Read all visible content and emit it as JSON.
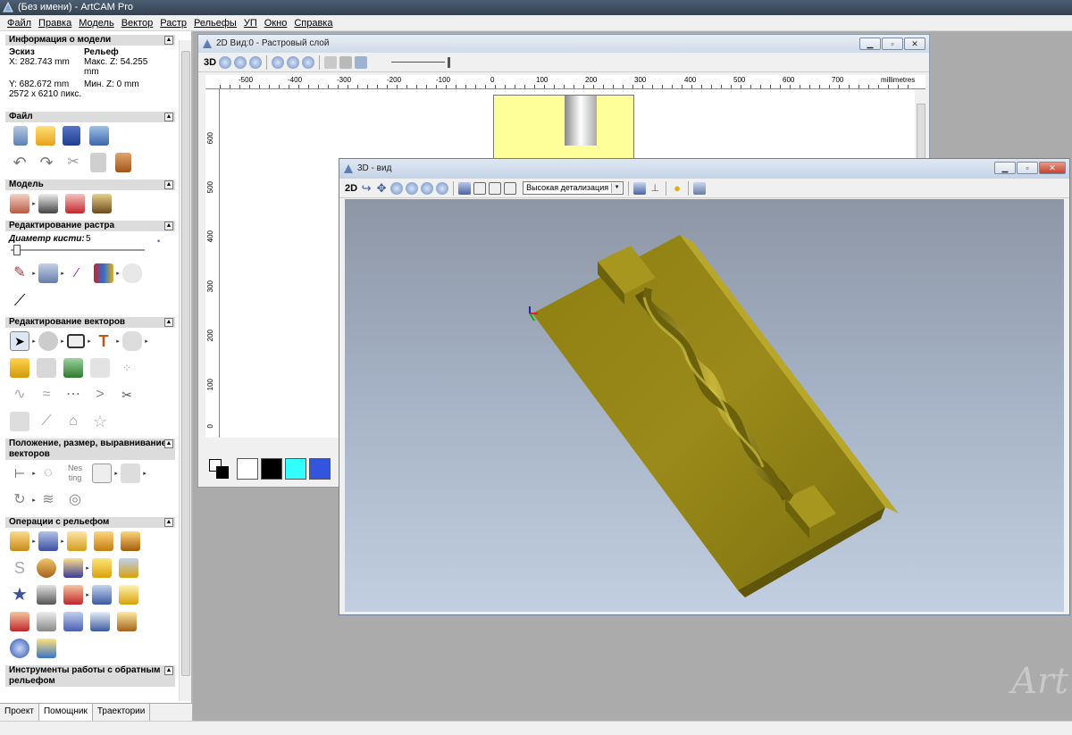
{
  "app": {
    "title": "(Без имени) - ArtCAM Pro"
  },
  "menu": [
    "Файл",
    "Правка",
    "Модель",
    "Вектор",
    "Растр",
    "Рельефы",
    "УП",
    "Окно",
    "Справка"
  ],
  "left_panel": {
    "model_info": {
      "header": "Информация о модели",
      "sketch_label": "Эскиз",
      "relief_label": "Рельеф",
      "x": "X: 282.743 mm",
      "max_z": "Макс. Z: 54.255 mm",
      "y": "Y: 682.672 mm",
      "min_z": "Мин. Z: 0 mm",
      "pixels": "2572 x 6210 пикс."
    },
    "sections": {
      "file": "Файл",
      "model": "Модель",
      "raster_edit": "Редактирование растра",
      "brush_label": "Диаметр кисти:",
      "brush_value": "5",
      "vector_edit": "Редактирование векторов",
      "position": "Положение, размер, выравнивание векторов",
      "relief_ops": "Операции с рельефом",
      "reverse_relief": "Инструменты работы с обратным рельефом"
    },
    "tabs": [
      "Проект",
      "Помощник",
      "Траектории"
    ]
  },
  "win2d": {
    "title": "2D Вид:0 - Растровый слой",
    "mode_label": "3D",
    "ruler_units": "millimetres",
    "ruler_x_ticks": [
      "-500",
      "-400",
      "-300",
      "-200",
      "-100",
      "0",
      "100",
      "200",
      "300",
      "400",
      "500",
      "600",
      "700"
    ],
    "ruler_y_ticks": [
      "600",
      "500",
      "400",
      "300",
      "200",
      "100",
      "0"
    ],
    "palette": [
      "#ffffff",
      "#000000",
      "#33ffff",
      "#3355dd"
    ]
  },
  "win3d": {
    "title": "3D - вид",
    "mode_label": "2D",
    "detail_select": "Высокая детализация"
  },
  "watermark": "Art"
}
